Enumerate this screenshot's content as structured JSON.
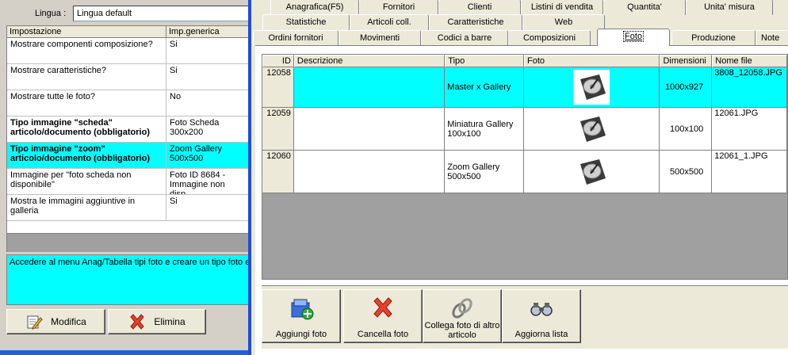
{
  "left": {
    "language_label": "Lingua :",
    "language_value": "Lingua default",
    "grid": {
      "headers": [
        "Impostazione",
        "Imp.generica"
      ],
      "rows": [
        {
          "setting": "Mostrare componenti composizione?",
          "value": "Si",
          "bold": false,
          "selected": false
        },
        {
          "setting": "Mostrare caratteristiche?",
          "value": "Si",
          "bold": false,
          "selected": false
        },
        {
          "setting": "Mostrare tutte le foto?",
          "value": "No",
          "bold": false,
          "selected": false
        },
        {
          "setting": "Tipo immagine \"scheda\" articolo/documento (obbligatorio)",
          "value": "Foto Scheda 300x200",
          "bold": true,
          "selected": false
        },
        {
          "setting": "Tipo immagine \"zoom\" articolo/documento (obbligatorio)",
          "value": "Zoom Gallery 500x500",
          "bold": true,
          "selected": true
        },
        {
          "setting": "Immagine per \"foto scheda non disponibile\"",
          "value": "Foto ID 8684 - Immagine non disp...",
          "bold": false,
          "selected": false
        },
        {
          "setting": "Mostra le immagini aggiuntive in galleria",
          "value": "Si",
          "bold": false,
          "selected": false
        }
      ]
    },
    "description": "Accedere al menu Anag/Tabella tipi foto e creare un tipo foto e",
    "edit_label": "Modifica",
    "delete_label": "Elimina"
  },
  "tabs": {
    "row1": [
      "Anagrafica(F5)",
      "Fornitori",
      "Clienti",
      "Listini di vendita",
      "Quantita'",
      "Unita' misura"
    ],
    "row2": [
      "Statistiche",
      "Articoli coll.",
      "Caratteristiche",
      "Web"
    ],
    "row3": [
      "Ordini fornitori",
      "Movimenti",
      "Codici a barre",
      "Composizioni",
      "Foto",
      "Produzione",
      "Note"
    ],
    "active": "Foto"
  },
  "photos": {
    "headers": [
      "ID",
      "Descrizione",
      "Tipo",
      "Foto",
      "Dimensioni",
      "Nome file"
    ],
    "rows": [
      {
        "id": "12058",
        "description": "",
        "type": "Master x Gallery",
        "dimensions": "1000x927",
        "file": "3808_12058.JPG",
        "selected": true
      },
      {
        "id": "12059",
        "description": "",
        "type": "Miniatura Gallery 100x100",
        "dimensions": "100x100",
        "file": "12061.JPG",
        "selected": false
      },
      {
        "id": "12060",
        "description": "",
        "type": "Zoom Gallery 500x500",
        "dimensions": "500x500",
        "file": "12061_1.JPG",
        "selected": false
      }
    ]
  },
  "actions": {
    "add_label": "Aggiungi foto",
    "delete_label": "Cancella foto",
    "link_label": "Collega foto di altro articolo",
    "refresh_label": "Aggiorna lista"
  },
  "colors": {
    "selection": "#00ffff",
    "panel": "#ece9d8",
    "divider": "#1f4fd1"
  }
}
